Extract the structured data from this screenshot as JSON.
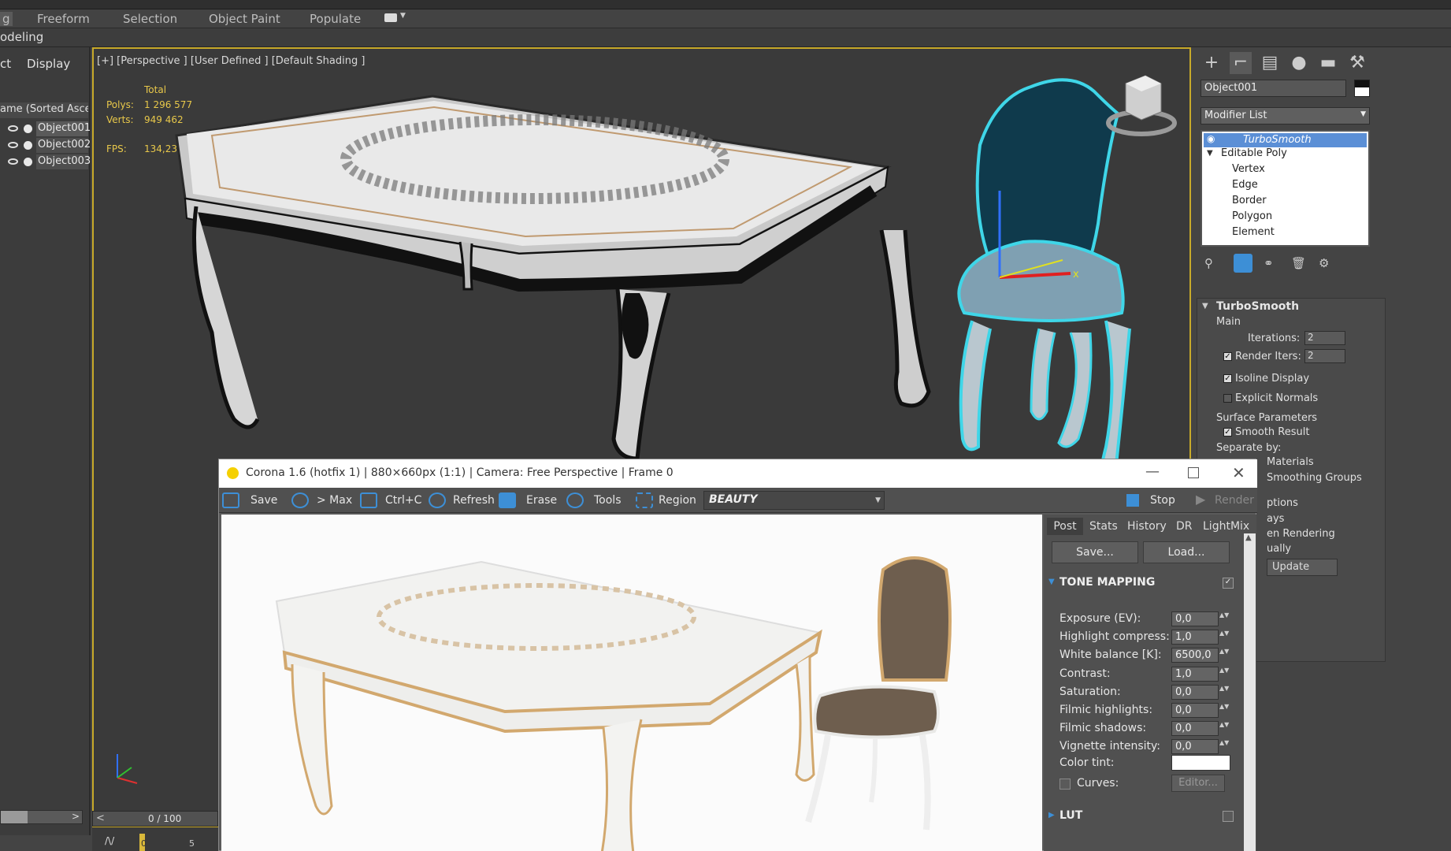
{
  "ribbon": {
    "tabs": [
      "g",
      "Freeform",
      "Selection",
      "Object Paint",
      "Populate"
    ],
    "sub_label": "odeling"
  },
  "explorer": {
    "menu": [
      "ct",
      "Display"
    ],
    "header": "ame (Sorted Ascen",
    "objects": [
      "Object001",
      "Object002",
      "Object003"
    ]
  },
  "viewport": {
    "label": "[+] [Perspective ] [User Defined ] [Default Shading ]",
    "stats": {
      "total_label": "Total",
      "polys_label": "Polys:",
      "polys_value": "1 296 577",
      "verts_label": "Verts:",
      "verts_value": "949 462",
      "fps_label": "FPS:",
      "fps_value": "134,238"
    },
    "gizmo_axis": "x"
  },
  "timeline": {
    "frame_display": "0 / 100",
    "prev": "<",
    "next": ">",
    "tick_0": "0",
    "tick_5": "5"
  },
  "command_panel": {
    "object_name": "Object001",
    "modifier_list": "Modifier List",
    "stack": [
      "TurboSmooth",
      "Editable Poly",
      "Vertex",
      "Edge",
      "Border",
      "Polygon",
      "Element"
    ],
    "turbosmooth": {
      "title": "TurboSmooth",
      "main_label": "Main",
      "iterations_label": "Iterations:",
      "iterations_value": "2",
      "render_iters_label": "Render Iters:",
      "render_iters_value": "2",
      "isoline_label": "Isoline Display",
      "explicit_normals_label": "Explicit Normals",
      "surface_params_label": "Surface Parameters",
      "smooth_result_label": "Smooth Result",
      "separate_by_label": "Separate by:",
      "materials_label": "Materials",
      "smoothing_groups_label": "Smoothing Groups",
      "options_label": "ptions",
      "ays_label": "ays",
      "en_rendering_label": "en Rendering",
      "ually_label": "ually",
      "update_label": "Update"
    }
  },
  "vfb": {
    "title": "Corona 1.6 (hotfix 1) | 880×660px (1:1) | Camera: Free Perspective | Frame 0",
    "toolbar": [
      "Save",
      "> Max",
      "Ctrl+C",
      "Refresh",
      "Erase",
      "Tools",
      "Region"
    ],
    "pass": "BEAUTY",
    "stop_label": "Stop",
    "render_label": "Render",
    "tabs": [
      "Post",
      "Stats",
      "History",
      "DR",
      "LightMix"
    ],
    "save_btn": "Save...",
    "load_btn": "Load...",
    "tone_mapping": "TONE MAPPING",
    "params": [
      {
        "label": "Exposure (EV):",
        "value": "0,0"
      },
      {
        "label": "Highlight compress:",
        "value": "1,0"
      },
      {
        "label": "White balance [K]:",
        "value": "6500,0"
      },
      {
        "label": "Contrast:",
        "value": "1,0"
      },
      {
        "label": "Saturation:",
        "value": "0,0"
      },
      {
        "label": "Filmic highlights:",
        "value": "0,0"
      },
      {
        "label": "Filmic shadows:",
        "value": "0,0"
      },
      {
        "label": "Vignette intensity:",
        "value": "0,0"
      }
    ],
    "color_tint_label": "Color tint:",
    "curves_label": "Curves:",
    "editor_btn": "Editor...",
    "lut_label": "LUT"
  },
  "colors": {
    "accent": "#3d8fd6",
    "viewport_border": "#c8aa2a",
    "selection_outline": "#3fd6e8",
    "stats": "#e8c84a"
  }
}
